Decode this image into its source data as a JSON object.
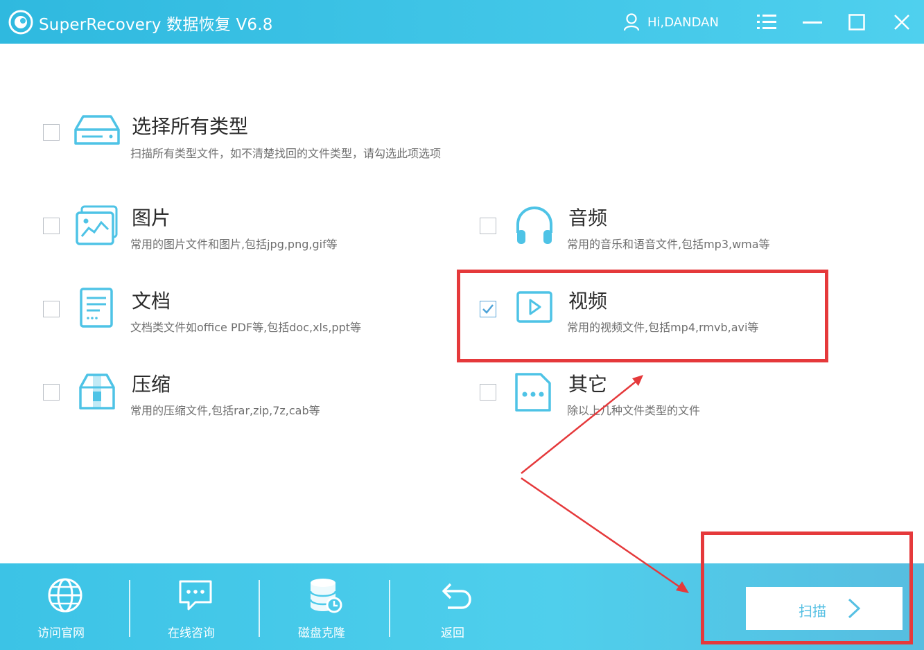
{
  "titlebar": {
    "app_title": "SuperRecovery 数据恢复 V6.8",
    "user_name": "Hi,DANDAN"
  },
  "options": {
    "all": {
      "title": "选择所有类型",
      "desc": "扫描所有类型文件，如不清楚找回的文件类型，请勾选此项选项",
      "checked": false
    },
    "picture": {
      "title": "图片",
      "desc": "常用的图片文件和图片,包括jpg,png,gif等",
      "checked": false
    },
    "audio": {
      "title": "音频",
      "desc": "常用的音乐和语音文件,包括mp3,wma等",
      "checked": false
    },
    "document": {
      "title": "文档",
      "desc": "文档类文件如office PDF等,包括doc,xls,ppt等",
      "checked": false
    },
    "video": {
      "title": "视频",
      "desc": "常用的视频文件,包括mp4,rmvb,avi等",
      "checked": true
    },
    "archive": {
      "title": "压缩",
      "desc": "常用的压缩文件,包括rar,zip,7z,cab等",
      "checked": false
    },
    "other": {
      "title": "其它",
      "desc": "除以上几种文件类型的文件",
      "checked": false
    }
  },
  "toolbar": {
    "website_label": "访问官网",
    "consult_label": "在线咨询",
    "clone_label": "磁盘克隆",
    "back_label": "返回",
    "scan_label": "扫描"
  },
  "colors": {
    "accent": "#4fcfec",
    "icon": "#4ec3e6",
    "annotation": "#e5393b"
  }
}
